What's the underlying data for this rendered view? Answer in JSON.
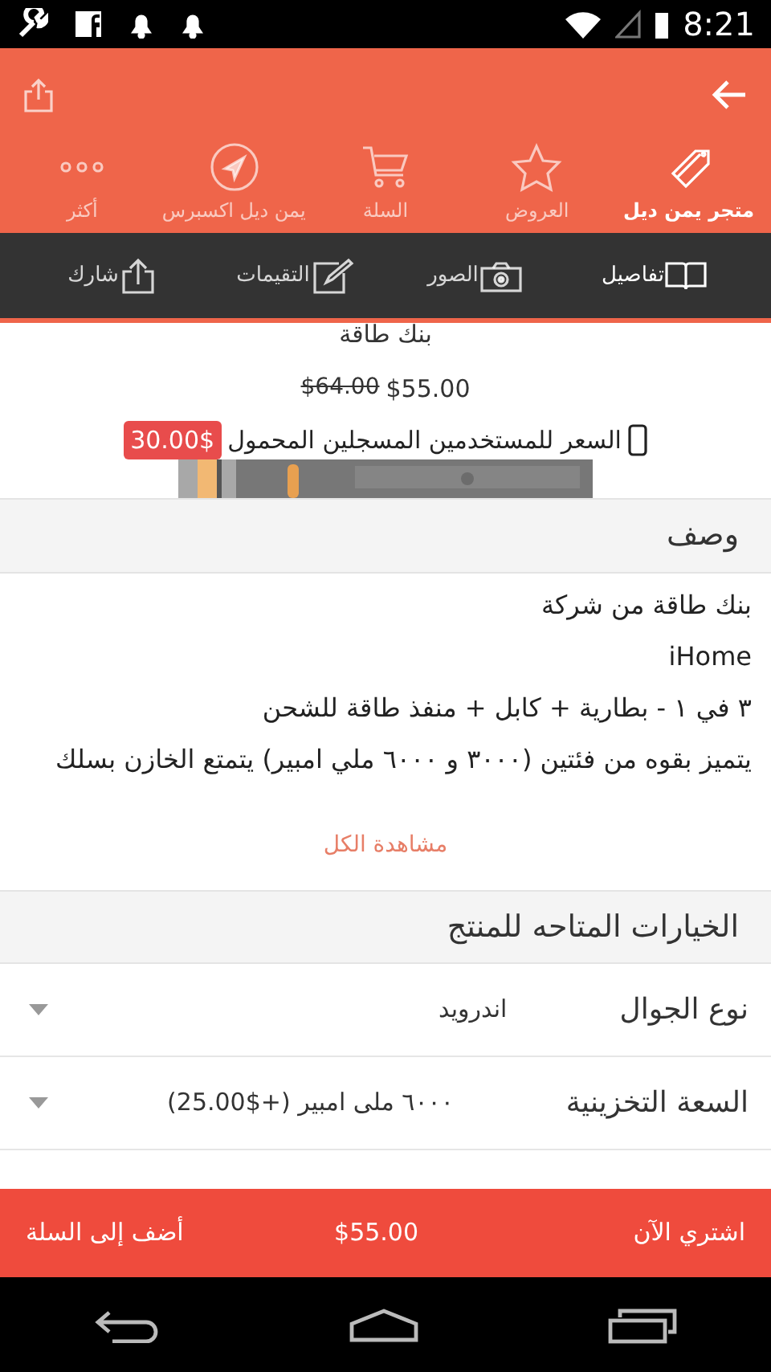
{
  "status_bar": {
    "time": "8:21"
  },
  "nav_items": [
    {
      "label": "متجر يمن ديل",
      "selected": true
    },
    {
      "label": "العروض",
      "selected": false
    },
    {
      "label": "السلة",
      "selected": false
    },
    {
      "label": "يمن ديل اكسبرس",
      "selected": false
    },
    {
      "label": "أكثر",
      "selected": false
    }
  ],
  "tabs": [
    {
      "label": "تفاصيل",
      "selected": true
    },
    {
      "label": "الصور",
      "selected": false
    },
    {
      "label": "التقيمات",
      "selected": false
    },
    {
      "label": "شارك",
      "selected": false
    }
  ],
  "product": {
    "title": "بنك طاقة",
    "old_price": "$64.00",
    "price": "$55.00",
    "mobile_price_label": "السعر للمستخدمين المسجلين المحمول",
    "mobile_price": "30.00$"
  },
  "description": {
    "title": "وصف",
    "lines": [
      "بنك طاقة من شركة",
      "iHome",
      "٣ في ١ - بطارية + كابل + منفذ طاقة للشحن",
      "يتميز بقوه من فئتين (٣٠٠٠ و ٦٠٠٠ ملي امبير) يتمتع الخازن بسلك"
    ],
    "see_all": "مشاهدة الكل"
  },
  "options": {
    "title": "الخيارات المتاحه للمنتج",
    "items": [
      {
        "label": "نوع الجوال",
        "value": "اندرويد"
      },
      {
        "label": "السعة التخزينية",
        "value": "٦٠٠٠ ملى امبير (+$25.00)"
      }
    ]
  },
  "bottom_bar": {
    "buy_now": "اشتري الآن",
    "price": "$55.00",
    "add_to_cart": "أضف إلى السلة"
  }
}
